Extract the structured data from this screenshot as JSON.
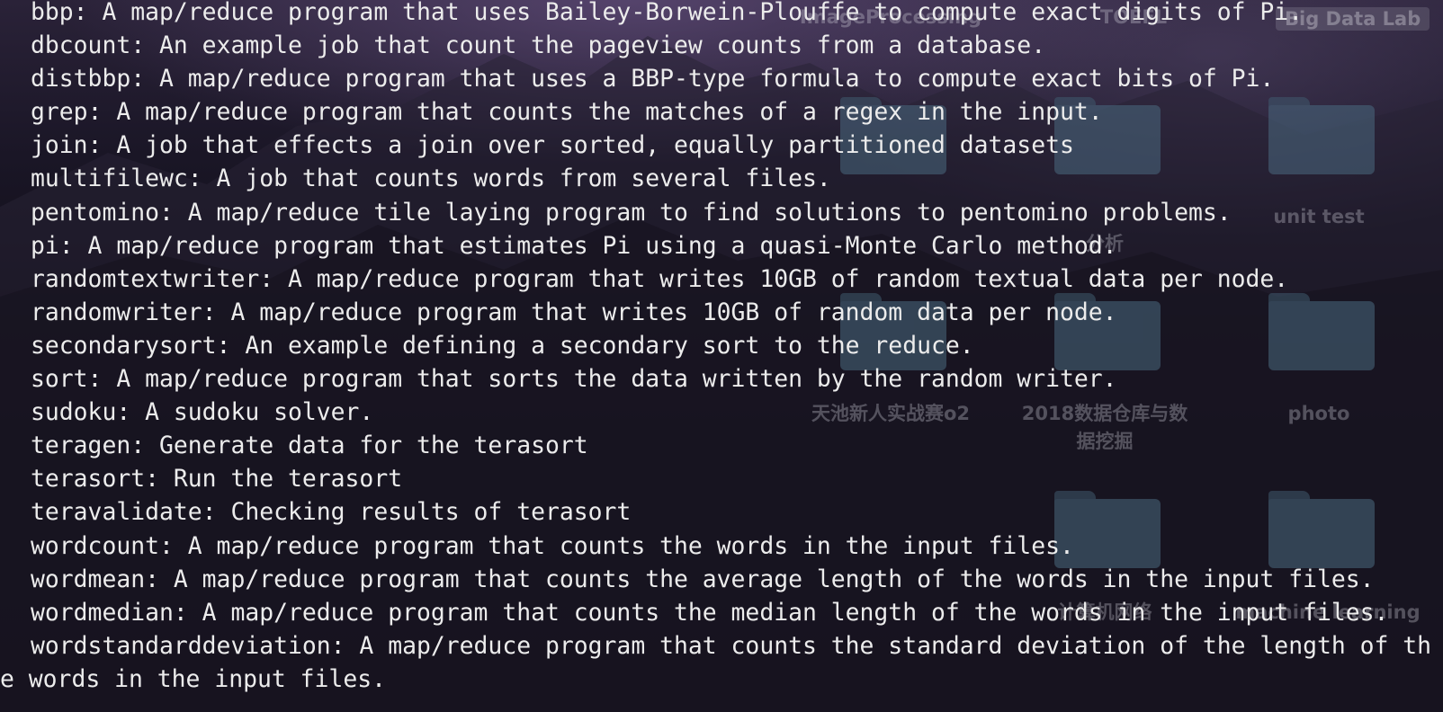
{
  "terminal": {
    "lines": [
      "bbp: A map/reduce program that uses Bailey-Borwein-Plouffe to compute exact digits of Pi.",
      "dbcount: An example job that count the pageview counts from a database.",
      "distbbp: A map/reduce program that uses a BBP-type formula to compute exact bits of Pi.",
      "grep: A map/reduce program that counts the matches of a regex in the input.",
      "join: A job that effects a join over sorted, equally partitioned datasets",
      "multifilewc: A job that counts words from several files.",
      "pentomino: A map/reduce tile laying program to find solutions to pentomino problems.",
      "pi: A map/reduce program that estimates Pi using a quasi-Monte Carlo method.",
      "randomtextwriter: A map/reduce program that writes 10GB of random textual data per node.",
      "randomwriter: A map/reduce program that writes 10GB of random data per node.",
      "secondarysort: An example defining a secondary sort to the reduce.",
      "sort: A map/reduce program that sorts the data written by the random writer.",
      "sudoku: A sudoku solver.",
      "teragen: Generate data for the terasort",
      "terasort: Run the terasort",
      "teravalidate: Checking results of terasort",
      "wordcount: A map/reduce program that counts the words in the input files.",
      "wordmean: A map/reduce program that counts the average length of the words in the input files.",
      "wordmedian: A map/reduce program that counts the median length of the words in the input files.",
      "wordstandarddeviation: A map/reduce program that counts the standard deviation of the length of th",
      "e words in the input files."
    ]
  },
  "desktop": {
    "badge": "Big Data Lab",
    "labels": {
      "image_processing": "ImageProcessing",
      "toefl": "TOEFL",
      "unit_test": "unit test",
      "tianchi": "天池新人实战赛o2",
      "dw_line1": "2018数据仓库与数",
      "dw_line2": "据挖掘",
      "photo": "photo",
      "network": "计算机网络",
      "machine_learning": "machine learning",
      "analysis": "分析"
    }
  }
}
